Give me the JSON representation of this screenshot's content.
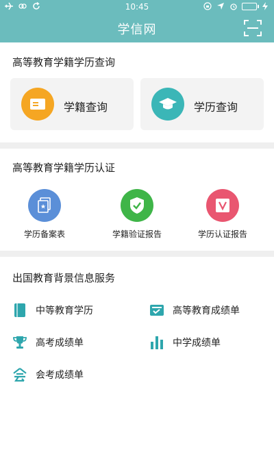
{
  "status_bar": {
    "time": "10:45",
    "battery_level": 1.0,
    "left_icons": [
      "airplane-icon",
      "sync-icon",
      "refresh-icon"
    ],
    "right_icons": [
      "lock-rotation-icon",
      "location-icon",
      "alarm-icon",
      "battery-icon",
      "charging-icon"
    ]
  },
  "nav": {
    "title": "学信网",
    "scan_icon": "scan-icon"
  },
  "colors": {
    "primary": "#6bbcbd",
    "card_bg": "#f3f3f3",
    "divider": "#efefef",
    "orange": "#f5a623",
    "teal": "#3bb6b7",
    "blue": "#5b8fd8",
    "green": "#3fb548",
    "pink": "#e95670",
    "icon_teal": "#2ea6ad"
  },
  "section_query": {
    "title": "高等教育学籍学历查询",
    "cards": [
      {
        "label": "学籍查询",
        "icon": "id-card-icon"
      },
      {
        "label": "学历查询",
        "icon": "graduation-cap-icon"
      }
    ]
  },
  "section_cert": {
    "title": "高等教育学籍学历认证",
    "items": [
      {
        "label": "学历备案表",
        "icon": "record-form-icon"
      },
      {
        "label": "学籍验证报告",
        "icon": "verified-shield-icon"
      },
      {
        "label": "学历认证报告",
        "icon": "certificate-v-icon"
      }
    ]
  },
  "section_abroad": {
    "title": "出国教育背景信息服务",
    "items": [
      {
        "label": "中等教育学历",
        "icon": "book-icon"
      },
      {
        "label": "高等教育成绩单",
        "icon": "transcript-check-icon"
      },
      {
        "label": "高考成绩单",
        "icon": "trophy-icon"
      },
      {
        "label": "中学成绩单",
        "icon": "bar-chart-icon"
      },
      {
        "label": "会考成绩单",
        "icon": "hui-character-icon"
      }
    ]
  }
}
